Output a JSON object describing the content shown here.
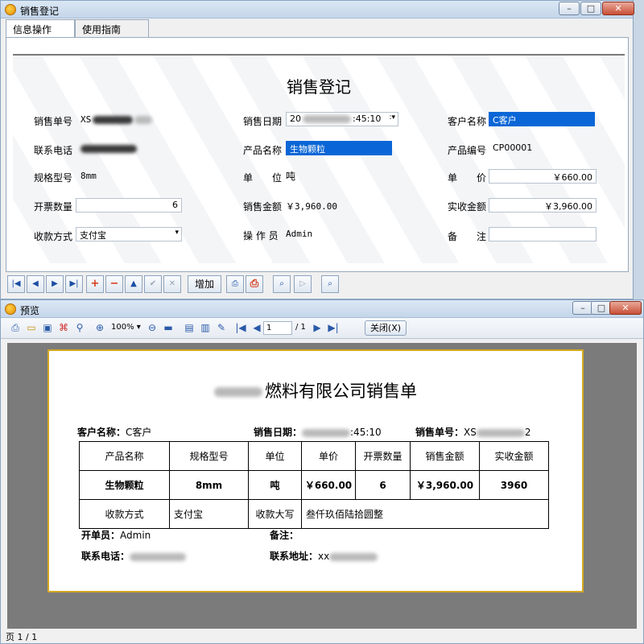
{
  "window1": {
    "title": "销售登记",
    "tabs": [
      "信息操作",
      "使用指南"
    ],
    "form_title": "销售登记",
    "fields": {
      "order_no_label": "销售单号",
      "order_no_value": "XS",
      "sale_date_label": "销售日期",
      "sale_date_value": "20",
      "sale_date_time": ":45:10",
      "customer_label": "客户名称",
      "customer_value": "C客户",
      "phone_label": "联系电话",
      "product_name_label": "产品名称",
      "product_name_value": "生物颗粒",
      "product_code_label": "产品编号",
      "product_code_value": "CP00001",
      "spec_label": "规格型号",
      "spec_value": "8mm",
      "unit_label": "单　　位",
      "unit_value": "吨",
      "price_label": "单　　价",
      "price_value": "￥660.00",
      "qty_label": "开票数量",
      "qty_value": "6",
      "amount_label": "销售金额",
      "amount_value": "￥3,960.00",
      "received_label": "实收金额",
      "received_value": "￥3,960.00",
      "payment_label": "收款方式",
      "payment_value": "支付宝",
      "operator_label": "操 作 员",
      "operator_value": "Admin",
      "remark_label": "备　　注",
      "remark_value": ""
    },
    "nav": {
      "add_label": "增加"
    }
  },
  "window2": {
    "title": "预览",
    "zoom": "100%",
    "page_current": "1",
    "page_total": "/ 1",
    "close_label": "关闭(X)",
    "status": "页 1 / 1",
    "document": {
      "title_suffix": "燃料有限公司销售单",
      "customer_label": "客户名称：",
      "customer_value": "C客户",
      "date_label": "销售日期：",
      "date_value": ":45:10",
      "order_label": "销售单号：",
      "order_value": "XS",
      "order_tail": "2",
      "headers": [
        "产品名称",
        "规格型号",
        "单位",
        "单价",
        "开票数量",
        "销售金额",
        "实收金额"
      ],
      "row": [
        "生物颗粒",
        "8mm",
        "吨",
        "￥660.00",
        "6",
        "￥3,960.00",
        "3960"
      ],
      "payment_label": "收款方式",
      "payment_value": "支付宝",
      "uppercase_label": "收款大写",
      "uppercase_value": "叁仟玖佰陆拾圆整",
      "issuer_label": "开单员：",
      "issuer_value": "Admin",
      "remark_label": "备注：",
      "remark_value": "",
      "phone_label": "联系电话：",
      "address_label": "联系地址：",
      "address_value": "xx"
    }
  }
}
